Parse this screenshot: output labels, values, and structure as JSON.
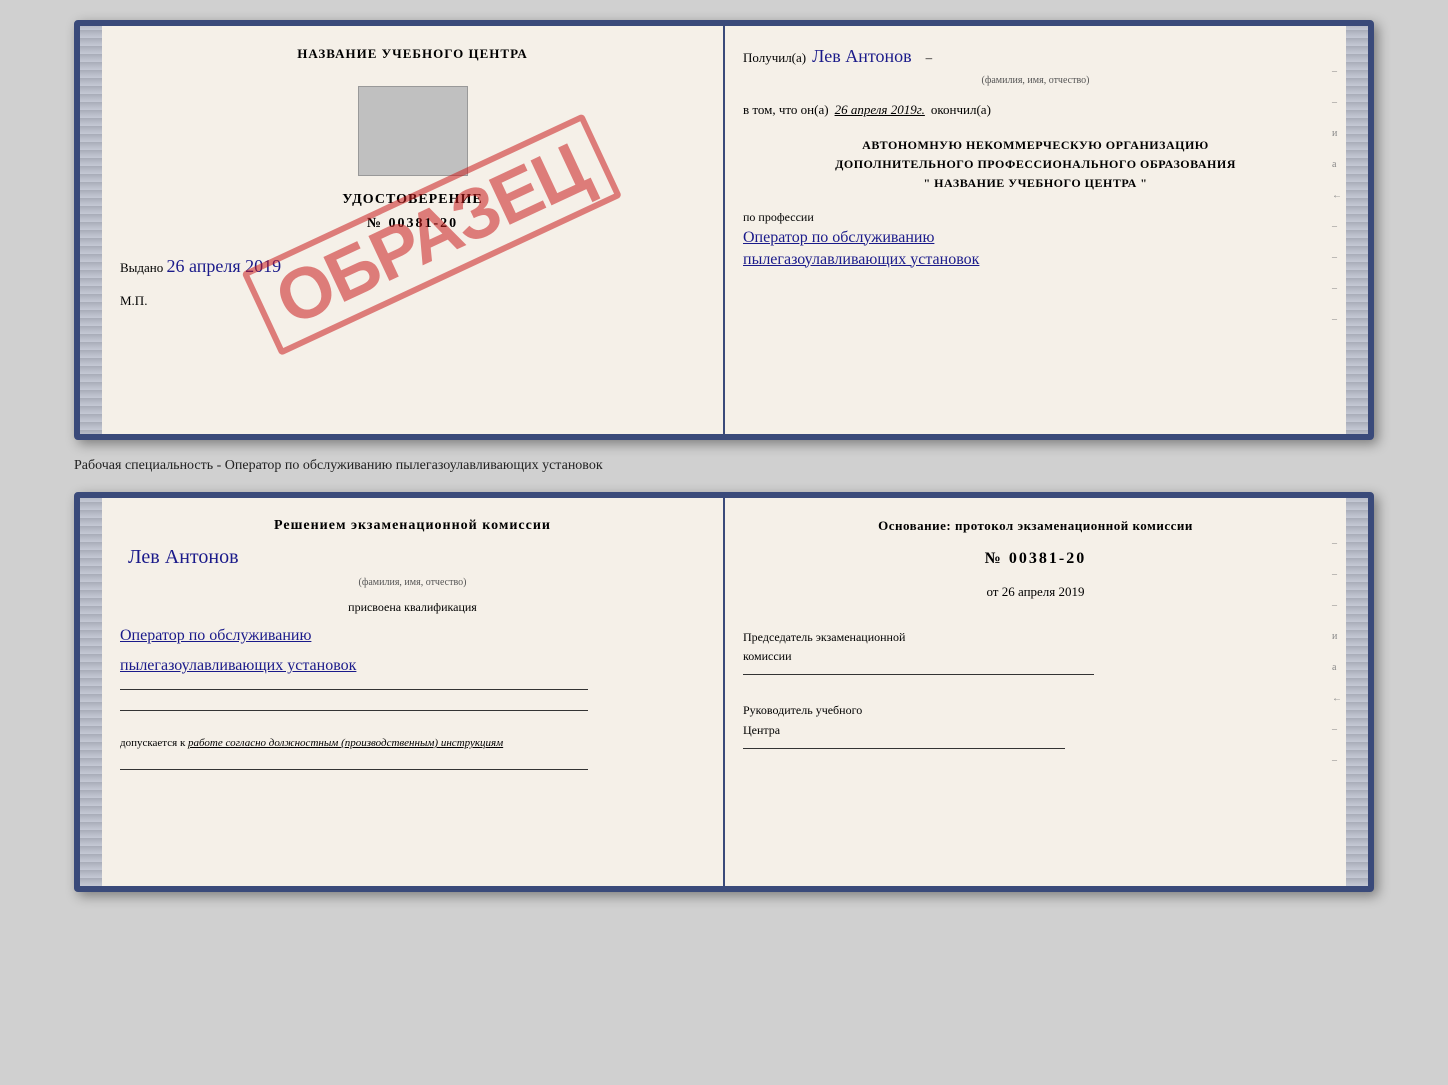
{
  "cert1": {
    "left": {
      "title": "НАЗВАНИЕ УЧЕБНОГО ЦЕНТРА",
      "udostoverenie": "УДОСТОВЕРЕНИЕ",
      "number": "№ 00381-20",
      "vydano_label": "Выдано",
      "vydano_date": "26 апреля 2019",
      "mp": "М.П.",
      "obrazets": "ОБРАЗЕЦ"
    },
    "right": {
      "poluchil_label": "Получил(а)",
      "poluchil_name": "Лев Антонов",
      "fio_hint": "(фамилия, имя, отчество)",
      "vtom_label": "в том, что он(а)",
      "vtom_date": "26 апреля 2019г.",
      "okonchil": "окончил(а)",
      "org_line1": "АВТОНОМНУЮ НЕКОММЕРЧЕСКУЮ ОРГАНИЗАЦИЮ",
      "org_line2": "ДОПОЛНИТЕЛЬНОГО ПРОФЕССИОНАЛЬНОГО ОБРАЗОВАНИЯ",
      "org_line3": "\"   НАЗВАНИЕ УЧЕБНОГО ЦЕНТРА   \"",
      "professiya_label": "по профессии",
      "professiya_line1": "Оператор по обслуживанию",
      "professiya_line2": "пылегазоулавливающих установок"
    }
  },
  "middle_caption": "Рабочая специальность - Оператор по обслуживанию пылегазоулавливающих установок",
  "cert2": {
    "left": {
      "resheniye": "Решением экзаменационной комиссии",
      "name": "Лев Антонов",
      "fio_hint": "(фамилия, имя, отчество)",
      "prisvoena": "присвоена квалификация",
      "kvalif_line1": "Оператор по обслуживанию",
      "kvalif_line2": "пылегазоулавливающих установок",
      "dopuskaetsya_label": "допускается к",
      "dopuskaetsya_text": "работе согласно должностным (производственным) инструкциям"
    },
    "right": {
      "osnovaniye": "Основание: протокол экзаменационной комиссии",
      "number": "№  00381-20",
      "ot_label": "от",
      "ot_date": "26 апреля 2019",
      "predsedatel_line1": "Председатель экзаменационной",
      "predsedatel_line2": "комиссии",
      "rukovoditel_line1": "Руководитель учебного",
      "rukovoditel_line2": "Центра"
    }
  }
}
